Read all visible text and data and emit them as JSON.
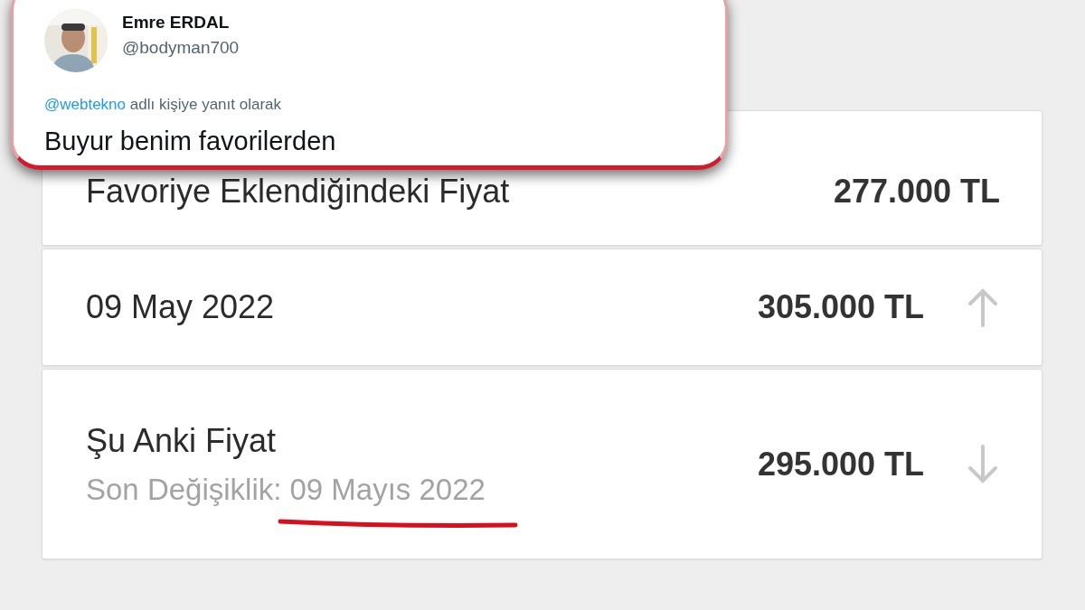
{
  "tweet": {
    "name": "Emre ERDAL",
    "handle": "@bodyman700",
    "reply_to": {
      "mention": "@webtekno",
      "text": "adlı kişiye yanıt olarak"
    },
    "body": "Buyur benim favorilerden"
  },
  "price_rows": [
    {
      "kind": "plain",
      "label": "Favoriye Eklendiğindeki Fiyat",
      "price": "277.000 TL"
    },
    {
      "kind": "trend",
      "label": "09 May 2022",
      "price": "305.000 TL",
      "rising": true
    },
    {
      "kind": "trend",
      "label": "Şu Anki Fiyat",
      "note_label": "Son Değişiklik:",
      "note_date": "09 Mayıs 2022",
      "date_underlined": true,
      "price": "295.000 TL",
      "rising": false
    }
  ]
}
